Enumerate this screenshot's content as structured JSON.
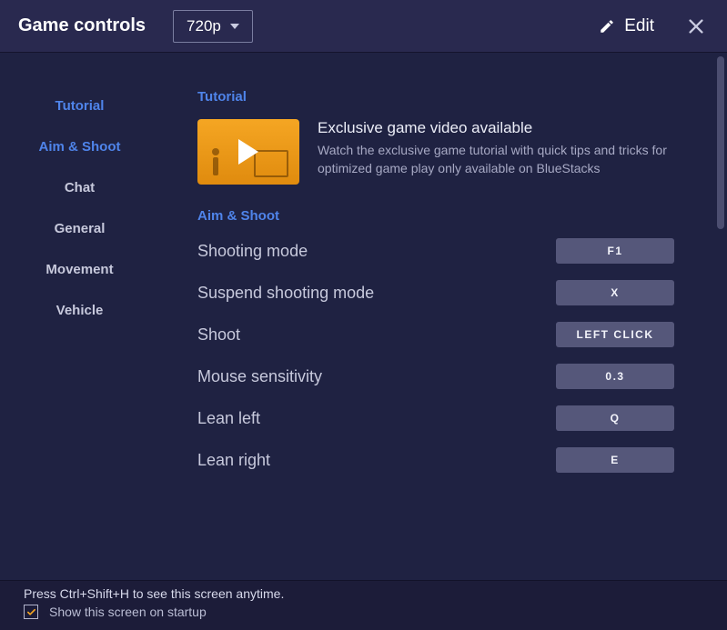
{
  "header": {
    "title": "Game controls",
    "resolution": "720p",
    "edit_label": "Edit"
  },
  "sidebar": {
    "items": [
      {
        "label": "Tutorial",
        "active": true
      },
      {
        "label": "Aim & Shoot",
        "active": true
      },
      {
        "label": "Chat",
        "active": false
      },
      {
        "label": "General",
        "active": false
      },
      {
        "label": "Movement",
        "active": false
      },
      {
        "label": "Vehicle",
        "active": false
      }
    ]
  },
  "content": {
    "tutorial": {
      "section_title": "Tutorial",
      "heading": "Exclusive game video available",
      "description": "Watch the exclusive game tutorial with quick tips and tricks for optimized game play only available on BlueStacks"
    },
    "aim_shoot": {
      "section_title": "Aim & Shoot",
      "bindings": [
        {
          "label": "Shooting mode",
          "key": "F1"
        },
        {
          "label": "Suspend shooting mode",
          "key": "X"
        },
        {
          "label": "Shoot",
          "key": "LEFT CLICK"
        },
        {
          "label": "Mouse sensitivity",
          "key": "0.3"
        },
        {
          "label": "Lean left",
          "key": "Q"
        },
        {
          "label": "Lean right",
          "key": "E"
        }
      ]
    }
  },
  "footer": {
    "hint": "Press Ctrl+Shift+H to see this screen anytime.",
    "show_on_startup_label": "Show this screen on startup",
    "show_on_startup_checked": true
  }
}
